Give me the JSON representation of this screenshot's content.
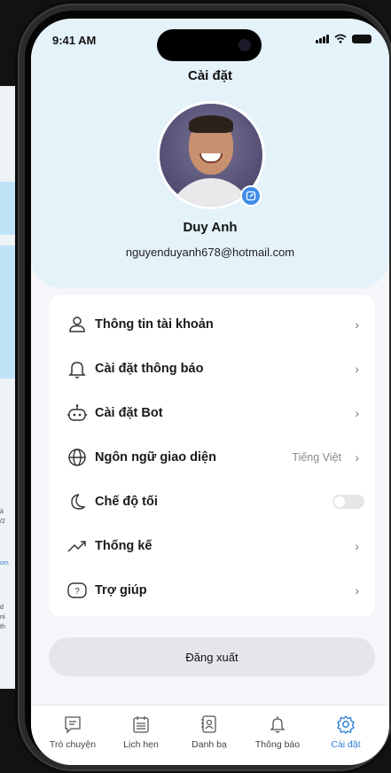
{
  "status_bar": {
    "time": "9:41 AM"
  },
  "header": {
    "title": "Cài đặt"
  },
  "profile": {
    "name": "Duy Anh",
    "email": "nguyenduyanh678@hotmail.com"
  },
  "menu": {
    "items": [
      {
        "label": "Thông tin tài khoản",
        "icon": "user-icon"
      },
      {
        "label": "Cài đặt thông báo",
        "icon": "bell-icon"
      },
      {
        "label": "Cài đặt Bot",
        "icon": "bot-icon"
      },
      {
        "label": "Ngôn ngữ giao diện",
        "icon": "globe-icon",
        "value": "Tiếng Việt"
      },
      {
        "label": "Chế độ tối",
        "icon": "moon-icon",
        "toggle": false
      },
      {
        "label": "Thống kế",
        "icon": "trend-icon"
      },
      {
        "label": "Trợ giúp",
        "icon": "help-icon"
      }
    ]
  },
  "logout_label": "Đăng xuất",
  "tabs": [
    {
      "label": "Trò chuyện",
      "icon": "chat-icon"
    },
    {
      "label": "Lịch hẹn",
      "icon": "calendar-icon"
    },
    {
      "label": "Danh bạ",
      "icon": "contacts-icon"
    },
    {
      "label": "Thông báo",
      "icon": "bell-icon"
    },
    {
      "label": "Cài đặt",
      "icon": "settings-icon",
      "active": true
    }
  ],
  "background_app": {
    "lines": [
      "à",
      "/2",
      "om",
      "d",
      "nì",
      "th"
    ]
  },
  "colors": {
    "accent": "#2d7fd6",
    "header_bg": "#e4f2fa",
    "screen_bg": "#f4f6f9"
  }
}
